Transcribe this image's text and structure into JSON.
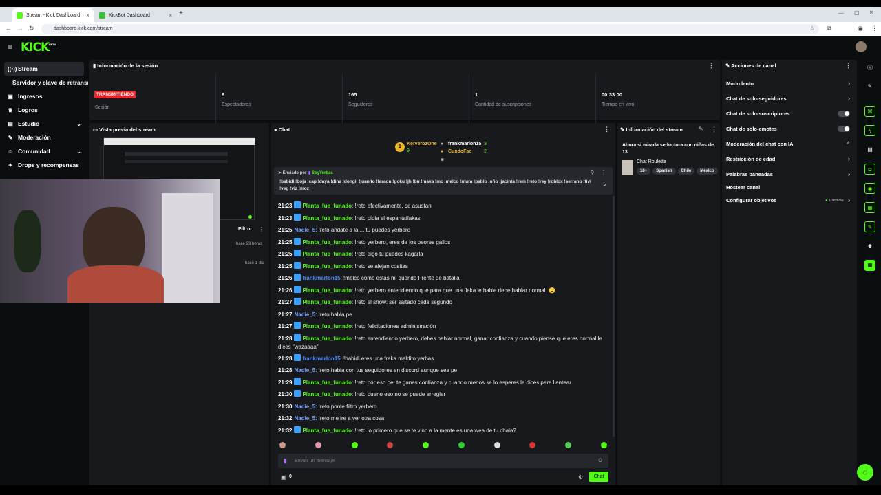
{
  "browser": {
    "tabs": [
      {
        "title": "Stream - Kick Dashboard"
      },
      {
        "title": "KickBot Dashboard"
      }
    ],
    "url": "dashboard.kick.com/stream"
  },
  "app": {
    "logo": "KICK",
    "logo_badge": "BETA"
  },
  "nav": {
    "items": [
      {
        "label": "Stream",
        "icon": "broadcast-icon"
      },
      {
        "label": "Servidor y clave de retransmisión"
      },
      {
        "label": "Ingresos",
        "icon": "wallet-icon"
      },
      {
        "label": "Logros",
        "icon": "trophy-icon"
      },
      {
        "label": "Estudio",
        "icon": "studio-icon"
      },
      {
        "label": "Moderación",
        "icon": "wrench-icon"
      },
      {
        "label": "Comunidad",
        "icon": "people-icon"
      },
      {
        "label": "Drops y recompensas",
        "icon": "gift-icon"
      }
    ]
  },
  "session": {
    "title": "Información de la sesión",
    "status": "TRANSMITIENDO",
    "stats": [
      {
        "label": "Sesión",
        "value": ""
      },
      {
        "label": "Espectadores",
        "value": "6"
      },
      {
        "label": "Seguidores",
        "value": "165"
      },
      {
        "label": "Cantidad de suscripciones",
        "value": "1"
      },
      {
        "label": "Tiempo en vivo",
        "value": "00:33:00"
      }
    ]
  },
  "preview": {
    "title": "Vista previa del stream",
    "filter_label": "Filtro",
    "times": [
      "hace 23 horas",
      "hace 1 día"
    ]
  },
  "chat": {
    "title": "Chat",
    "leaderboard": [
      {
        "name": "KerverozOne",
        "count": "9",
        "rank": "1"
      },
      {
        "name": "frankmarlon15",
        "count": "3"
      },
      {
        "name": "CundoFac",
        "count": "2"
      }
    ],
    "pinned": {
      "label": "Enviado por",
      "user": "SoyYerbas",
      "text": "!babidi !boja !cap !daya !dina !dongil !juanito !faraon !goku !jh !bu !maka !mc !melco !mura !pablo !oño !jacinta !rem !reto !rey !roblox !serrano !tivi !veg !viz !moz"
    },
    "messages": [
      {
        "time": "21:23",
        "user": "Planta_fue_funado",
        "color": "green",
        "text": ": !reto efectivamente, se asustan"
      },
      {
        "time": "21:23",
        "user": "Planta_fue_funado",
        "color": "green",
        "text": ": !reto piola el espantaflakas"
      },
      {
        "time": "21:25",
        "user": "Nadie_5",
        "color": "lblue",
        "text": ": !reto andate a la ... tu puedes yerbero"
      },
      {
        "time": "21:25",
        "user": "Planta_fue_funado",
        "color": "green",
        "text": ": !reto yerbero, eres de los peores gallos"
      },
      {
        "time": "21:25",
        "user": "Planta_fue_funado",
        "color": "green",
        "text": ": !reto digo tu puedes kagarla"
      },
      {
        "time": "21:25",
        "user": "Planta_fue_funado",
        "color": "green",
        "text": ": !reto se alejan cositas"
      },
      {
        "time": "21:26",
        "user": "frankmarlon15",
        "color": "blue",
        "text": ": !melco como estás mi querido Frente de batalla"
      },
      {
        "time": "21:26",
        "user": "Planta_fue_funado",
        "color": "green",
        "text": ": !reto yerbero entendiendo que para que una flaka le hable debe hablar normal: 😮"
      },
      {
        "time": "21:27",
        "user": "Planta_fue_funado",
        "color": "green",
        "text": ": !reto el show: ser saltado cada segundo"
      },
      {
        "time": "21:27",
        "user": "Nadie_5",
        "color": "lblue",
        "text": ": !reto habla pe"
      },
      {
        "time": "21:27",
        "user": "Planta_fue_funado",
        "color": "green",
        "text": ": !reto felicitaciones administración"
      },
      {
        "time": "21:28",
        "user": "Planta_fue_funado",
        "color": "green",
        "text": ": !reto entendiendo yerbero, debes hablar normal, ganar confianza y cuando piense que eres normal le dices \"wazaaaa\"",
        "wrap": true
      },
      {
        "time": "21:28",
        "user": "frankmarlon15",
        "color": "blue",
        "text": ": !babidi eres una fraka maldito yerbas"
      },
      {
        "time": "21:28",
        "user": "Nadie_5",
        "color": "lblue",
        "text": ": !reto habla con tus seguidores en discord aunque sea pe"
      },
      {
        "time": "21:29",
        "user": "Planta_fue_funado",
        "color": "green",
        "text": ": !reto por eso pe, te ganas confianza y cuando menos se lo esperes le dices para llantear"
      },
      {
        "time": "21:30",
        "user": "Planta_fue_funado",
        "color": "green",
        "text": ": !reto bueno eso no se puede arreglar"
      },
      {
        "time": "21:30",
        "user": "Nadie_5",
        "color": "lblue",
        "text": ": !reto ponte filtro yerbero"
      },
      {
        "time": "21:32",
        "user": "Nadie_5",
        "color": "lblue",
        "text": ": !reto me ire a ver otra cosa"
      },
      {
        "time": "21:32",
        "user": "Planta_fue_funado",
        "color": "green",
        "text": ": !reto lo primero que se te vino a la mente es una wea de tu chala?"
      }
    ],
    "input_placeholder": "Enviar un mensaje",
    "points": "0",
    "send_label": "Chat"
  },
  "stream_info": {
    "title": "Información del stream",
    "stream_title": "Ahora si mirada seductora con niñas de 13",
    "category": "Chat Roulette",
    "tags": [
      "18+",
      "Spanish",
      "Chile",
      "México"
    ]
  },
  "channel_actions": {
    "title": "Acciones de canal",
    "items": [
      {
        "label": "Modo lento",
        "control": "chevron"
      },
      {
        "label": "Chat de solo-seguidores",
        "control": "chevron"
      },
      {
        "label": "Chat de solo-suscriptores",
        "control": "toggle",
        "on": false
      },
      {
        "label": "Chat de solo-emotes",
        "control": "toggle",
        "on": false
      },
      {
        "label": "Moderación del chat con IA",
        "control": "external"
      },
      {
        "label": "Restricción de edad",
        "control": "chevron"
      },
      {
        "label": "Palabras baneadas",
        "control": "chevron"
      },
      {
        "label": "Hostear canal",
        "control": "none"
      },
      {
        "label": "Configurar objetivos",
        "control": "chevron",
        "extra": "1 activas"
      }
    ]
  },
  "colors": {
    "accent": "#53fc18",
    "live": "#e5242b",
    "panel": "#18191d"
  }
}
